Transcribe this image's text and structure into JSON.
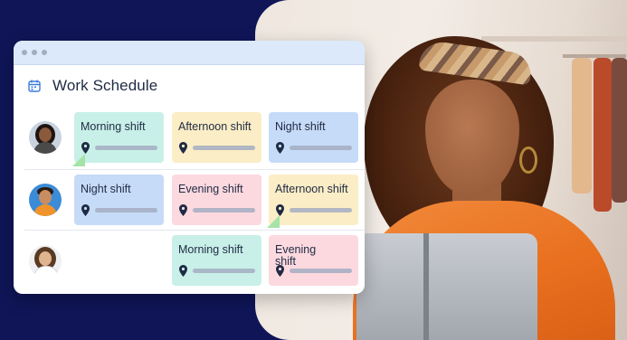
{
  "app": {
    "title": "Work Schedule"
  },
  "icons": {
    "calendar": "calendar-icon",
    "pin": "location-pin-icon"
  },
  "colors": {
    "background": "#0f1557",
    "titlebar": "#dbe9fb",
    "morning": "#c8f0e8",
    "afternoon": "#fbedc5",
    "night": "#c6dbf7",
    "evening": "#fcd9df",
    "flag": "#a6e3a8"
  },
  "schedule": [
    {
      "shifts": [
        "Morning shift",
        "Afternoon shift",
        "Night shift"
      ]
    },
    {
      "shifts": [
        "Night shift",
        "Evening shift",
        "Afternoon shift"
      ]
    },
    {
      "shifts": [
        "Morning shift",
        "Evening shift"
      ]
    }
  ]
}
